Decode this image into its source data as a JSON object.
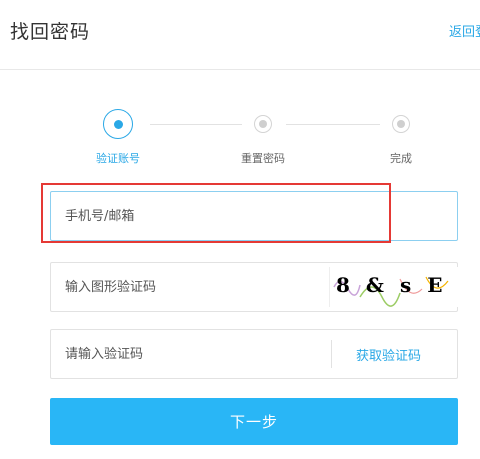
{
  "header": {
    "title": "找回密码",
    "back_label": "返回登"
  },
  "steps": [
    {
      "label": "验证账号",
      "state": "active"
    },
    {
      "label": "重置密码",
      "state": "pending"
    },
    {
      "label": "完成",
      "state": "pending"
    }
  ],
  "form": {
    "account_placeholder": "手机号/邮箱",
    "account_value": "",
    "captcha_placeholder": "输入图形验证码",
    "captcha_text": "8&sE",
    "sms_placeholder": "请输入验证码",
    "sms_button_label": "获取验证码",
    "next_button_label": "下一步"
  },
  "colors": {
    "accent": "#2aa8e6",
    "button": "#29b6f6",
    "highlight": "#e53935"
  }
}
